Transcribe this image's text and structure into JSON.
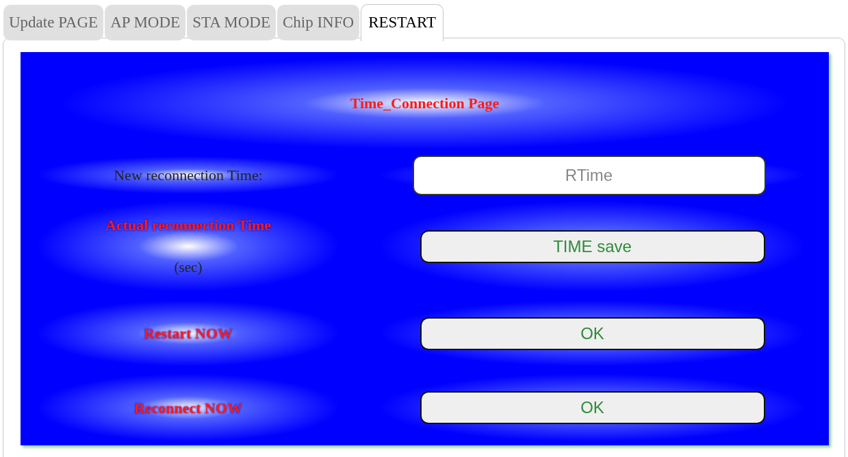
{
  "tabs": [
    {
      "label": "Update PAGE",
      "selected": false
    },
    {
      "label": "AP MODE",
      "selected": false
    },
    {
      "label": "STA MODE",
      "selected": false
    },
    {
      "label": "Chip INFO",
      "selected": false
    },
    {
      "label": "RESTART",
      "selected": true
    }
  ],
  "title": "Time_Connection Page",
  "rows": [
    {
      "kind": "input",
      "label": "New reconnection Time:",
      "highlighted": false,
      "placeholder": "RTime"
    },
    {
      "kind": "button",
      "label": "Actual reconnection Time",
      "note": "(sec)",
      "highlighted": true,
      "button": "TIME save"
    },
    {
      "kind": "button",
      "label": "Restart NOW",
      "highlighted": true,
      "button": "OK"
    },
    {
      "kind": "button",
      "label": "Reconnect NOW",
      "highlighted": true,
      "button": "OK"
    }
  ]
}
